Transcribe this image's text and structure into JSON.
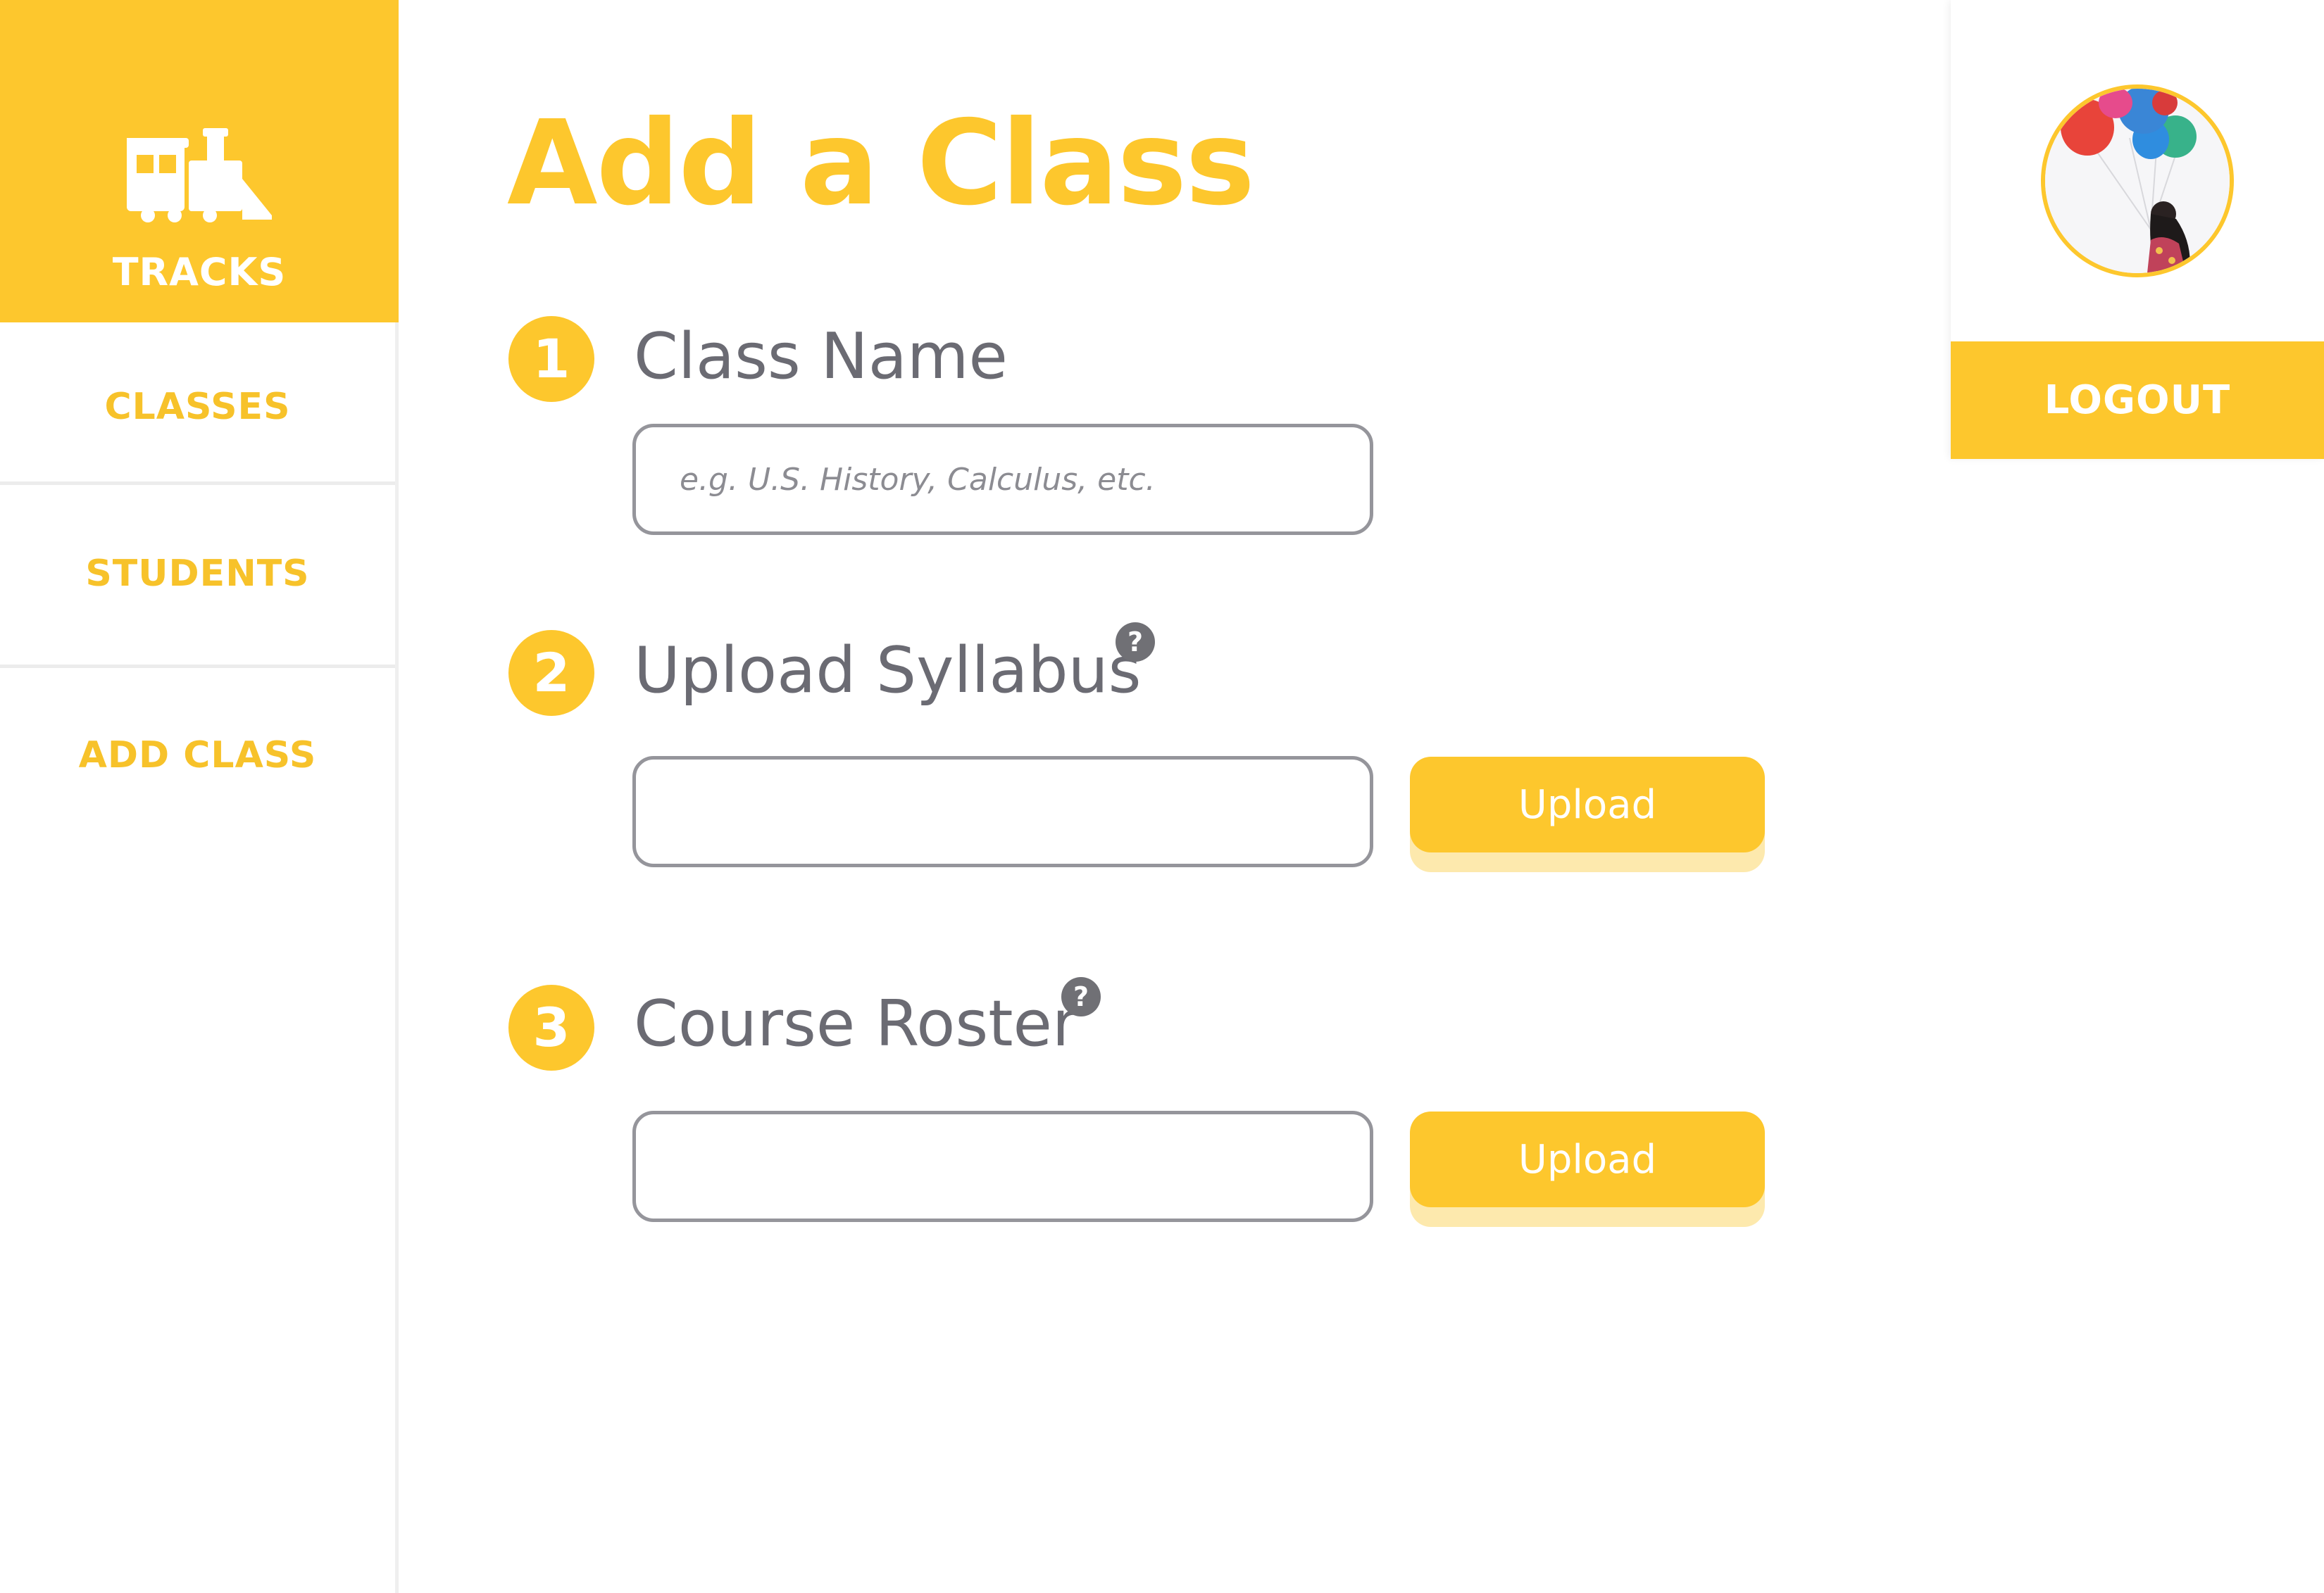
{
  "brand": {
    "label": "TRACKS",
    "icon": "train-icon"
  },
  "sidebar": {
    "items": [
      {
        "label": "CLASSES"
      },
      {
        "label": "STUDENTS"
      },
      {
        "label": "ADD CLASS"
      }
    ]
  },
  "page": {
    "title": "Add a Class"
  },
  "steps": [
    {
      "number": "1",
      "label": "Class Name",
      "placeholder": "e.g. U.S. History, Calculus, etc.",
      "value": ""
    },
    {
      "number": "2",
      "label": "Upload Syllabus",
      "help": "?",
      "value": "",
      "button": "Upload"
    },
    {
      "number": "3",
      "label": "Course Roster",
      "help": "?",
      "value": "",
      "button": "Upload"
    }
  ],
  "profile": {
    "avatar_icon": "user-avatar",
    "logout_label": "LOGOUT"
  },
  "colors": {
    "accent": "#fdc72d",
    "accent_light": "#fde9ad",
    "text_gray": "#6b6b73",
    "border_gray": "#95959b"
  }
}
